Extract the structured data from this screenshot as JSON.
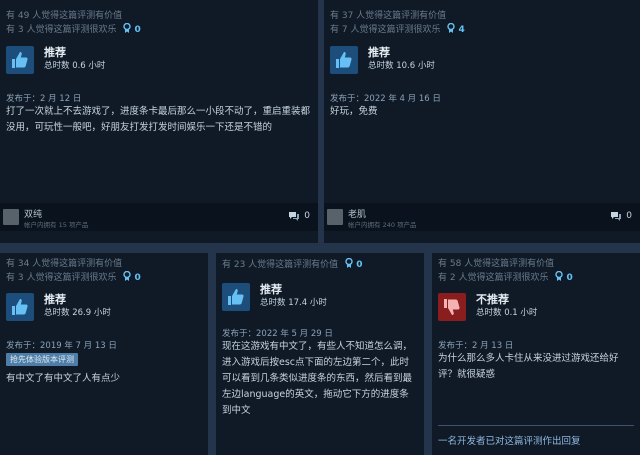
{
  "reviews": [
    {
      "helpful": "有 49 人觉得这篇评测有价值",
      "funny": "有 3 人觉得这篇评测很欢乐",
      "awards": "0",
      "recommendation": "推荐",
      "hours": "总时数 0.6 小时",
      "posted": "发布于：2 月 12 日",
      "text": "打了一次就上不去游戏了，进度条卡最后那么一小段不动了，重启重装都没用，可玩性一般吧，好朋友打发打发时间娱乐一下还是不错的",
      "username": "双纯",
      "products": "帐户内拥有 15 项产品",
      "comments": "0"
    },
    {
      "helpful": "有 37 人觉得这篇评测有价值",
      "funny": "有 7 人觉得这篇评测很欢乐",
      "awards": "4",
      "recommendation": "推荐",
      "hours": "总时数 10.6 小时",
      "posted": "发布于：2022 年 4 月 16 日",
      "text": "好玩，免费",
      "username": "老肌",
      "products": "帐户内拥有 240 项产品",
      "comments": "0"
    },
    {
      "helpful": "有 34 人觉得这篇评测有价值",
      "funny": "有 3 人觉得这篇评测很欢乐",
      "awards": "0",
      "recommendation": "推荐",
      "hours": "总时数 26.9 小时",
      "posted": "发布于：2019 年 7 月 13 日",
      "badge": "抢先体验版本评测",
      "text": "有中文了有中文了人有点少"
    },
    {
      "helpful": "有 23 人觉得这篇评测有价值",
      "awards": "0",
      "recommendation": "推荐",
      "hours": "总时数 17.4 小时",
      "posted": "发布于：2022 年 5 月 29 日",
      "text": "现在这游戏有中文了，有些人不知道怎么调，进入游戏后按esc点下面的左边第二个，此时可以看到几条类似进度条的东西，然后看到最左边language的英文，拖动它下方的进度条到中文"
    },
    {
      "helpful": "有 58 人觉得这篇评测有价值",
      "funny": "有 2 人觉得这篇评测很欢乐",
      "awards": "0",
      "recommendation": "不推荐",
      "hours": "总时数 0.1 小时",
      "posted": "发布于：2 月 13 日",
      "text": "为什么那么多人卡住从来没进过游戏还给好评？就很疑惑",
      "dev_reply": "一名开发者已对这篇评测作出回复"
    }
  ],
  "colors": {
    "accent": "#67c1f5",
    "thumb_up": "#1d4e7b",
    "thumb_down": "#8a1d1d"
  }
}
